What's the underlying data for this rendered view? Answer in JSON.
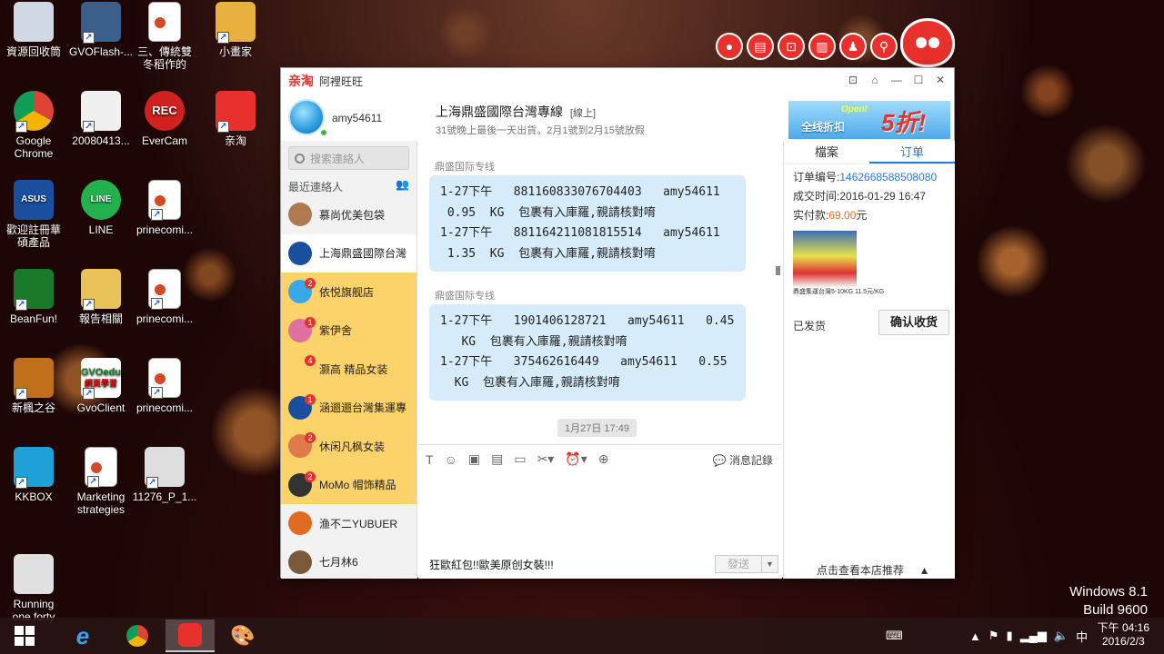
{
  "desktop_icons": [
    {
      "label": "資源回收筒"
    },
    {
      "label": "GVOFlash-..."
    },
    {
      "label": "三、傳統雙\n冬稻作的"
    },
    {
      "label": "小畫家"
    },
    {
      "label": "Google\nChrome"
    },
    {
      "label": "20080413..."
    },
    {
      "label": "EverCam"
    },
    {
      "label": "亲淘"
    },
    {
      "label": "歡迎註冊華\n碩產品"
    },
    {
      "label": "LINE"
    },
    {
      "label": "prinecomi..."
    },
    {
      "label": "BeanFun!"
    },
    {
      "label": "報告相關"
    },
    {
      "label": "prinecomi..."
    },
    {
      "label": "新楓之谷"
    },
    {
      "label": "GvoClient"
    },
    {
      "label": "prinecomi..."
    },
    {
      "label": "KKBOX"
    },
    {
      "label": "Marketing\nstrategies"
    },
    {
      "label": "11276_P_1..."
    },
    {
      "label": "Running\none forty"
    }
  ],
  "icon_texts": {
    "asus": "ASUS",
    "line": "LINE",
    "rec": "REC",
    "gvo": "GVOedu",
    "gvo_sub": "網頁學習"
  },
  "window": {
    "brand": "亲淘",
    "app_name": "阿裡旺旺",
    "username": "amy54611",
    "contact_title": "上海鼎盛國際台灣專線",
    "contact_status": "[線上]",
    "contact_sub": "31號晚上最後一天出貨。2月1號到2月15號放假",
    "ad_open": "Open!",
    "ad_text1": "全线折扣",
    "ad_text2": "5折!"
  },
  "sidebar": {
    "search_placeholder": "搜索連絡人",
    "recent_label": "最近連絡人",
    "contacts": [
      {
        "name": "慕尚优美包袋",
        "badge": ""
      },
      {
        "name": "上海鼎盛國際台灣",
        "badge": ""
      },
      {
        "name": "依悦旗舰店",
        "badge": "2"
      },
      {
        "name": "紫伊舍",
        "badge": "1"
      },
      {
        "name": "灏高 精品女装",
        "badge": "4"
      },
      {
        "name": "涵逦逦台灣集運專",
        "badge": "1"
      },
      {
        "name": "休闲凡枫女装",
        "badge": "2"
      },
      {
        "name": "MoMo 帽饰精品",
        "badge": "2"
      },
      {
        "name": "渔不二YUBUER",
        "badge": ""
      },
      {
        "name": "七月林6",
        "badge": ""
      }
    ]
  },
  "chat": {
    "messages": [
      {
        "sender": "鼎盛国际专线",
        "text": "1-27下午   881160833076704403   amy54611\n 0.95  KG  包裹有入庫羅,親請核對唷\n1-27下午   881164211081815514   amy54611\n 1.35  KG  包裹有入庫羅,親請核對唷"
      },
      {
        "sender": "鼎盛国际专线",
        "text": "1-27下午   1901406128721   amy54611   0.45\n   KG  包裹有入庫羅,親請核對唷\n1-27下午   375462616449   amy54611   0.55\n  KG  包裹有入庫羅,親請核對唷"
      }
    ],
    "time_chip": "1月27日 17:49",
    "history_label": "消息記錄",
    "input_text": "狂歐紅包!!歐美原创女裝!!!",
    "send_label": "發送"
  },
  "right_panel": {
    "tabs": [
      "檔案",
      "订单"
    ],
    "order_no_label": "订单编号:",
    "order_no": "1462668588508080",
    "time_label": "成交时间:",
    "time_value": "2016-01-29 16:47",
    "paid_label": "实付款:",
    "paid_value": "69.00",
    "paid_unit": "元",
    "product_caption": "鼎盛集運台灣5-10KG 11.5元/KG",
    "status": "已发货",
    "confirm_button": "确认收货",
    "shop_rec": "点击查看本店推荐"
  },
  "watermark": {
    "line1": "Windows 8.1",
    "line2": "Build 9600"
  },
  "taskbar": {
    "ime": "中",
    "time": "下午 04:16",
    "date": "2016/2/3"
  },
  "colors": {
    "taobao_red": "#e8312c",
    "bubble": "#d6ecfa",
    "highlight": "#fcd26a",
    "link_blue": "#2a7ad6"
  }
}
